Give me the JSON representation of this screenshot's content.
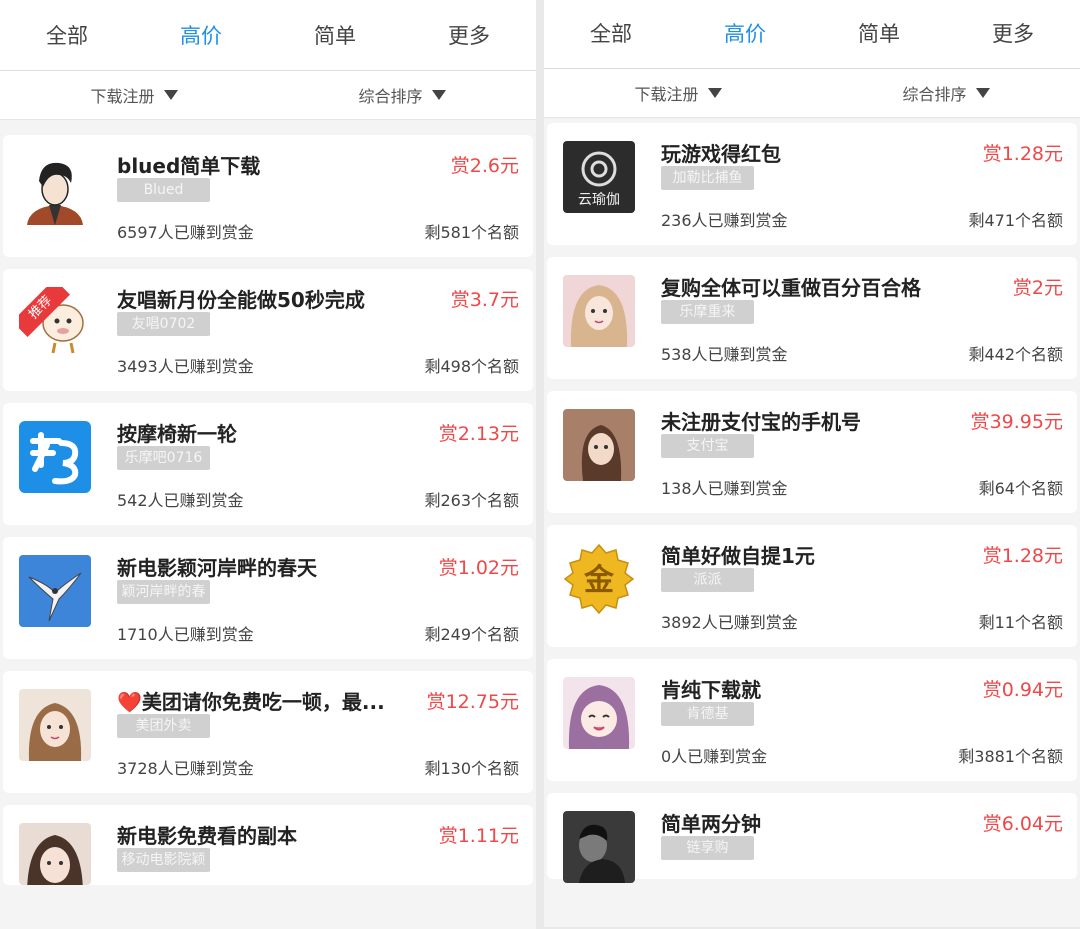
{
  "left": {
    "tabs": [
      {
        "label": "全部"
      },
      {
        "label": "高价"
      },
      {
        "label": "简单"
      },
      {
        "label": "更多"
      }
    ],
    "filters": [
      {
        "label": "下载注册"
      },
      {
        "label": "综合排序"
      }
    ],
    "cards": [
      {
        "title": "blued简单下载",
        "reward": "赏2.6元",
        "tag": "Blued",
        "earned": "6597人已赚到赏金",
        "quota": "剩581个名额",
        "avatar_icon": "cartoon-man-avatar-icon"
      },
      {
        "title": "友唱新月份全能做50秒完成",
        "reward": "赏3.7元",
        "tag": "友唱0702",
        "earned": "3493人已赚到赏金",
        "quota": "剩498个名额",
        "avatar_icon": "cartoon-sheep-avatar-icon",
        "ribbon": "推荐"
      },
      {
        "title": "按摩椅新一轮",
        "reward": "赏2.13元",
        "tag": "乐摩吧0716",
        "earned": "542人已赚到赏金",
        "quota": "剩263个名额",
        "avatar_icon": "bang-app-logo-icon"
      },
      {
        "title": "新电影颖河岸畔的春天",
        "reward": "赏1.02元",
        "tag": "颖河岸畔的春",
        "earned": "1710人已赚到赏金",
        "quota": "剩249个名额",
        "avatar_icon": "bird-photo-avatar-icon"
      },
      {
        "title": "❤️美团请你免费吃一顿，最...",
        "reward": "赏12.75元",
        "tag": "美团外卖",
        "earned": "3728人已赚到赏金",
        "quota": "剩130个名额",
        "avatar_icon": "girl-photo-avatar-icon"
      },
      {
        "title": "新电影免费看的副本",
        "reward": "赏1.11元",
        "tag": "移动电影院颖",
        "earned": "",
        "quota": "",
        "avatar_icon": "girl-photo-avatar-icon"
      }
    ]
  },
  "right": {
    "tabs": [
      {
        "label": "全部"
      },
      {
        "label": "高价"
      },
      {
        "label": "简单"
      },
      {
        "label": "更多"
      }
    ],
    "filters": [
      {
        "label": "下载注册"
      },
      {
        "label": "综合排序"
      }
    ],
    "cards": [
      {
        "title": "玩游戏得红包",
        "reward": "赏1.28元",
        "tag": "加勒比捕鱼",
        "earned": "236人已赚到赏金",
        "quota": "剩471个名额",
        "avatar_icon": "yunyouqie-logo-icon",
        "logo_text": "云瑜伽"
      },
      {
        "title": "复购全体可以重做百分百合格",
        "reward": "赏2元",
        "tag": "乐摩重来",
        "earned": "538人已赚到赏金",
        "quota": "剩442个名额",
        "avatar_icon": "girl-photo-avatar-icon"
      },
      {
        "title": "未注册支付宝的手机号",
        "reward": "赏39.95元",
        "tag": "支付宝",
        "earned": "138人已赚到赏金",
        "quota": "剩64个名额",
        "avatar_icon": "girl-photo-avatar-icon"
      },
      {
        "title": "简单好做自提1元",
        "reward": "赏1.28元",
        "tag": "派派",
        "earned": "3892人已赚到赏金",
        "quota": "剩11个名额",
        "avatar_icon": "gold-medal-icon",
        "logo_text": "金"
      },
      {
        "title": "肯纯下载就",
        "reward": "赏0.94元",
        "tag": "肯德基",
        "earned": "0人已赚到赏金",
        "quota": "剩3881个名额",
        "avatar_icon": "anime-girl-avatar-icon"
      },
      {
        "title": "简单两分钟",
        "reward": "赏6.04元",
        "tag": "链享购",
        "earned": "",
        "quota": "",
        "avatar_icon": "dark-photo-avatar-icon"
      }
    ]
  },
  "colors": {
    "accent": "#1e90e6",
    "reward": "#f04848",
    "tag_bg": "#d0d0d0",
    "background": "#f4f4f5"
  }
}
